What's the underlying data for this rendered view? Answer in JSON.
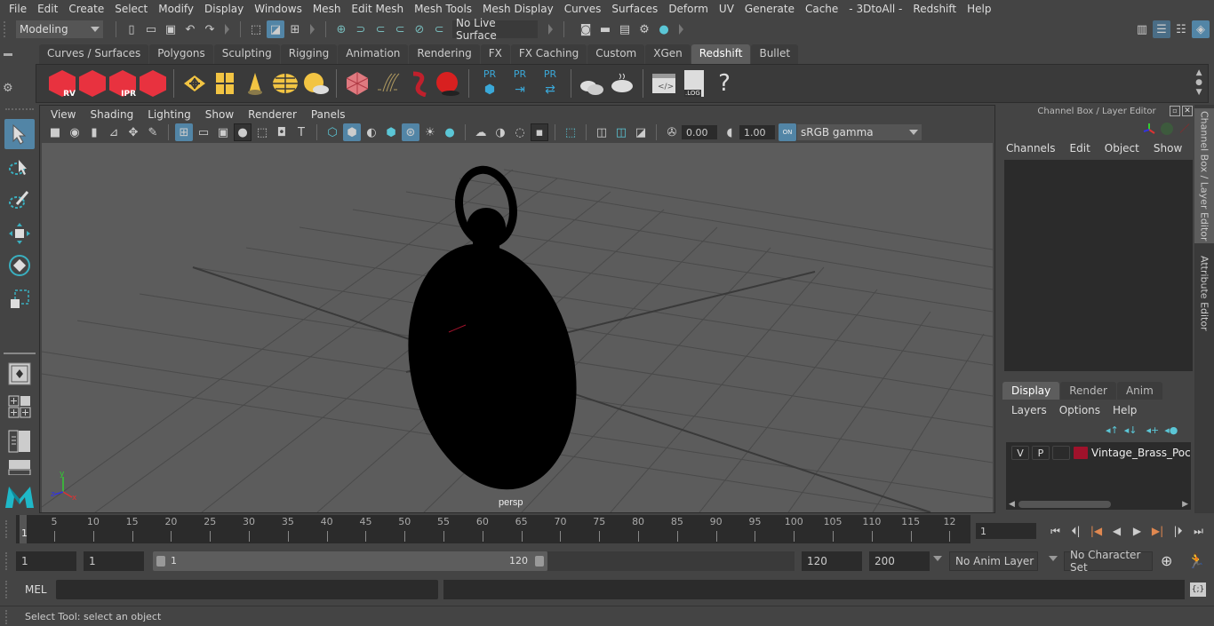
{
  "menubar": [
    "File",
    "Edit",
    "Create",
    "Select",
    "Modify",
    "Display",
    "Windows",
    "Mesh",
    "Edit Mesh",
    "Mesh Tools",
    "Mesh Display",
    "Curves",
    "Surfaces",
    "Deform",
    "UV",
    "Generate",
    "Cache",
    "- 3DtoAll -",
    "Redshift",
    "Help"
  ],
  "statusline": {
    "mode": "Modeling",
    "live_surface": "No Live Surface"
  },
  "shelf": {
    "tabs": [
      "Curves / Surfaces",
      "Polygons",
      "Sculpting",
      "Rigging",
      "Animation",
      "Rendering",
      "FX",
      "FX Caching",
      "Custom",
      "XGen",
      "Redshift",
      "Bullet"
    ],
    "active_tab": "Redshift",
    "icons": [
      {
        "name": "redshift-render-view-icon",
        "label": "RV"
      },
      {
        "name": "redshift-batch-render-icon",
        "label": ""
      },
      {
        "name": "redshift-ipr-icon",
        "label": "IPR"
      },
      {
        "name": "redshift-render-settings-icon",
        "label": ""
      },
      {
        "name": "redshift-area-light-icon",
        "label": ""
      },
      {
        "name": "redshift-portal-light-icon",
        "label": ""
      },
      {
        "name": "redshift-ies-light-icon",
        "label": ""
      },
      {
        "name": "redshift-dome-light-icon",
        "label": ""
      },
      {
        "name": "redshift-sun-sky-icon",
        "label": ""
      },
      {
        "name": "redshift-proxy-icon",
        "label": ""
      },
      {
        "name": "redshift-volume-icon",
        "label": ""
      },
      {
        "name": "redshift-hair-icon",
        "label": ""
      },
      {
        "name": "redshift-material-icon",
        "label": ""
      },
      {
        "name": "proxy-export-icon",
        "label": "PR"
      },
      {
        "name": "proxy-import-icon",
        "label": "PR"
      },
      {
        "name": "proxy-convert-icon",
        "label": "PR"
      },
      {
        "name": "bake-multiple-icon",
        "label": ""
      },
      {
        "name": "bake-icon",
        "label": ""
      },
      {
        "name": "redshift-script-icon",
        "label": ""
      },
      {
        "name": "redshift-log-icon",
        "label": ".LOG"
      },
      {
        "name": "help-icon",
        "label": "?"
      }
    ]
  },
  "viewport": {
    "menu": [
      "View",
      "Shading",
      "Lighting",
      "Show",
      "Renderer",
      "Panels"
    ],
    "exposure": "0.00",
    "gamma": "1.00",
    "color_management": "ON",
    "color_space": "sRGB gamma",
    "camera_label": "persp",
    "axis_labels": {
      "x": "x",
      "y": "y",
      "z": "z"
    }
  },
  "channel_box": {
    "title": "Channel Box / Layer Editor",
    "menu": [
      "Channels",
      "Edit",
      "Object",
      "Show"
    ],
    "layer_tabs": [
      "Display",
      "Render",
      "Anim"
    ],
    "active_layer_tab": "Display",
    "layer_menu": [
      "Layers",
      "Options",
      "Help"
    ],
    "layers": [
      {
        "visible": "V",
        "playback": "P",
        "type": "",
        "color": "#a0122b",
        "name": "Vintage_Brass_Pocket_"
      }
    ]
  },
  "side_tabs": [
    "Channel Box / Layer Editor",
    "Attribute Editor"
  ],
  "timeline": {
    "ticks": [
      5,
      10,
      15,
      20,
      25,
      30,
      35,
      40,
      45,
      50,
      55,
      60,
      65,
      70,
      75,
      80,
      85,
      90,
      95,
      100,
      105,
      110,
      115,
      "12"
    ],
    "current_frame_marker": "1",
    "current_frame": "1"
  },
  "range": {
    "start": "1",
    "playback_start": "1",
    "slider_start": "1",
    "slider_end": "120",
    "playback_end": "120",
    "end": "200",
    "anim_layer": "No Anim Layer",
    "character_set": "No Character Set"
  },
  "command": {
    "lang": "MEL",
    "input": "",
    "output": ""
  },
  "help_line": "Select Tool: select an object",
  "colors": {
    "accent": "#5285a6",
    "redshift": "#e8323f",
    "maya_logo": "#1fb8c8"
  }
}
